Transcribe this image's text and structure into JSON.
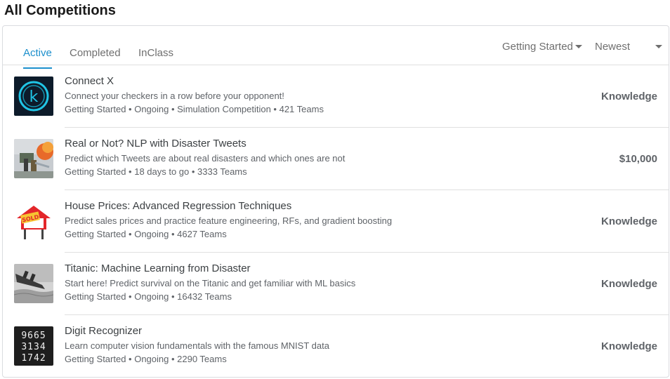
{
  "page": {
    "title": "All Competitions"
  },
  "tabs": [
    {
      "label": "Active",
      "active": true
    },
    {
      "label": "Completed",
      "active": false
    },
    {
      "label": "InClass",
      "active": false
    }
  ],
  "filters": {
    "category": "Getting Started",
    "sort": "Newest"
  },
  "competitions": [
    {
      "name": "Connect X",
      "description": "Connect your checkers in a row before your opponent!",
      "meta": "Getting Started • Ongoing • Simulation Competition • 421 Teams",
      "reward": "Knowledge",
      "thumb_icon": "connect-x-logo-icon",
      "thumb_letter": "k"
    },
    {
      "name": "Real or Not? NLP with Disaster Tweets",
      "description": "Predict which Tweets are about real disasters and which ones are not",
      "meta": "Getting Started • 18 days to go • 3333 Teams",
      "reward": "$10,000",
      "thumb_icon": "firefighter-fire-image"
    },
    {
      "name": "House Prices: Advanced Regression Techniques",
      "description": "Predict sales prices and practice feature engineering, RFs, and gradient boosting",
      "meta": "Getting Started • Ongoing • 4627 Teams",
      "reward": "Knowledge",
      "thumb_icon": "house-sold-sign-icon",
      "thumb_text": "SOLD"
    },
    {
      "name": "Titanic: Machine Learning from Disaster",
      "description": "Start here! Predict survival on the Titanic and get familiar with ML basics",
      "meta": "Getting Started • Ongoing • 16432 Teams",
      "reward": "Knowledge",
      "thumb_icon": "titanic-sinking-image"
    },
    {
      "name": "Digit Recognizer",
      "description": "Learn computer vision fundamentals with the famous MNIST data",
      "meta": "Getting Started • Ongoing • 2290 Teams",
      "reward": "Knowledge",
      "thumb_icon": "handwritten-digits-image",
      "thumb_digits": [
        "9665",
        "3134",
        "1742"
      ]
    }
  ]
}
